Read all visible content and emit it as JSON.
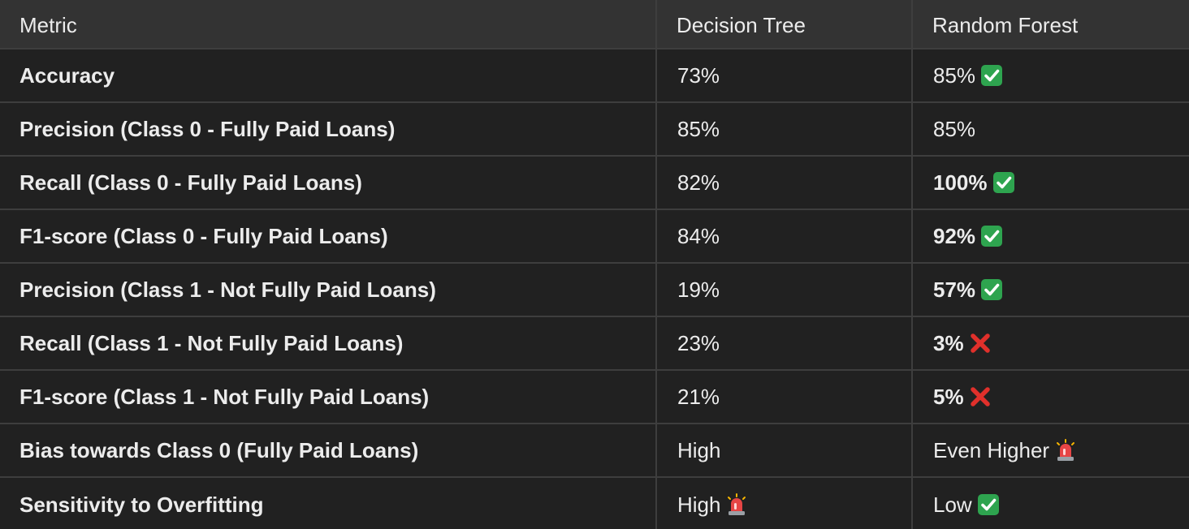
{
  "table": {
    "headers": [
      "Metric",
      "Decision Tree",
      "Random Forest"
    ],
    "rows": [
      {
        "metric": "Accuracy",
        "dt": "73%",
        "dt_icon": "",
        "dt_bold": false,
        "rf": "85%",
        "rf_icon": "check-icon",
        "rf_bold": false
      },
      {
        "metric": "Precision (Class 0 - Fully Paid Loans)",
        "dt": "85%",
        "dt_icon": "",
        "dt_bold": false,
        "rf": "85%",
        "rf_icon": "",
        "rf_bold": false
      },
      {
        "metric": "Recall (Class 0 - Fully Paid Loans)",
        "dt": "82%",
        "dt_icon": "",
        "dt_bold": false,
        "rf": "100%",
        "rf_icon": "check-icon",
        "rf_bold": true
      },
      {
        "metric": "F1-score (Class 0 - Fully Paid Loans)",
        "dt": "84%",
        "dt_icon": "",
        "dt_bold": false,
        "rf": "92%",
        "rf_icon": "check-icon",
        "rf_bold": true
      },
      {
        "metric": "Precision (Class 1 - Not Fully Paid Loans)",
        "dt": "19%",
        "dt_icon": "",
        "dt_bold": false,
        "rf": "57%",
        "rf_icon": "check-icon",
        "rf_bold": true
      },
      {
        "metric": "Recall (Class 1 - Not Fully Paid Loans)",
        "dt": "23%",
        "dt_icon": "",
        "dt_bold": false,
        "rf": "3%",
        "rf_icon": "cross-icon",
        "rf_bold": true
      },
      {
        "metric": "F1-score (Class 1 - Not Fully Paid Loans)",
        "dt": "21%",
        "dt_icon": "",
        "dt_bold": false,
        "rf": "5%",
        "rf_icon": "cross-icon",
        "rf_bold": true
      },
      {
        "metric": "Bias towards Class 0 (Fully Paid Loans)",
        "dt": "High",
        "dt_icon": "",
        "dt_bold": false,
        "rf": "Even Higher",
        "rf_icon": "siren-icon",
        "rf_bold": false
      },
      {
        "metric": "Sensitivity to Overfitting",
        "dt": "High",
        "dt_icon": "siren-icon",
        "dt_bold": false,
        "rf": "Low",
        "rf_icon": "check-icon",
        "rf_bold": false
      }
    ]
  },
  "colors": {
    "check_green": "#2ea44f",
    "cross_red": "#e0302b",
    "siren_red": "#e64545"
  }
}
